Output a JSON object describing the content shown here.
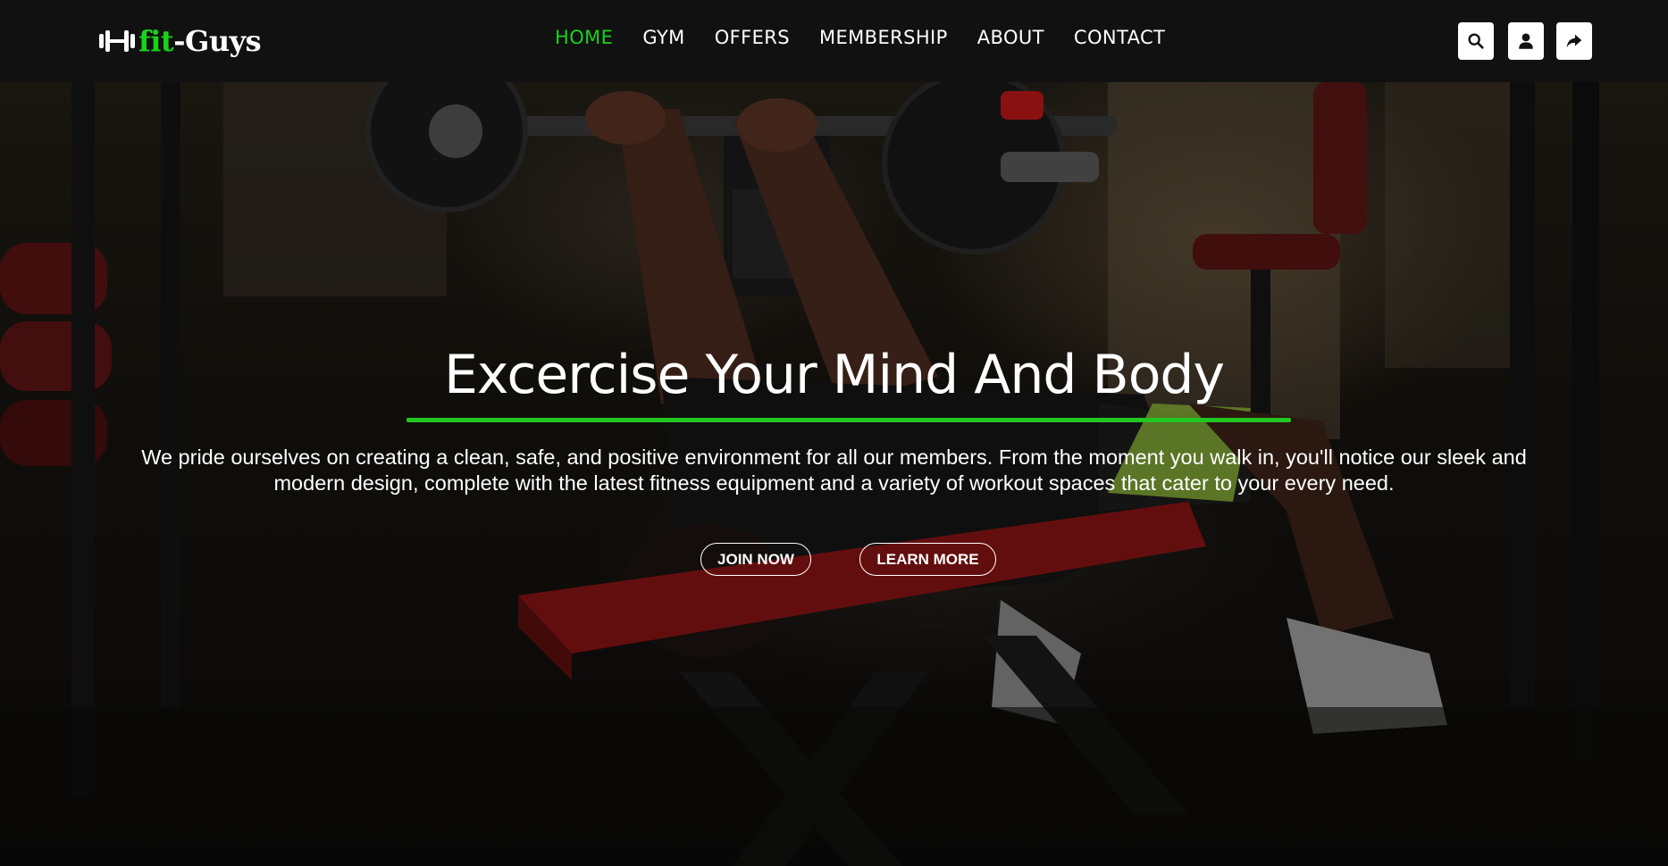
{
  "header": {
    "logo": {
      "icon": "dumbbell-icon",
      "accent_text": "fit",
      "rest_text": "-Guys"
    },
    "nav": [
      {
        "label": "HOME",
        "active": true
      },
      {
        "label": "GYM",
        "active": false
      },
      {
        "label": "OFFERS",
        "active": false
      },
      {
        "label": "MEMBERSHIP",
        "active": false
      },
      {
        "label": "ABOUT",
        "active": false
      },
      {
        "label": "CONTACT",
        "active": false
      }
    ],
    "actions": [
      {
        "icon": "search-icon"
      },
      {
        "icon": "user-icon"
      },
      {
        "icon": "share-icon"
      }
    ]
  },
  "hero": {
    "background": "gym-bench-press-photo",
    "title": "Excercise Your Mind And Body",
    "text": "We pride ourselves on creating a clean, safe, and positive environment for all our members. From the moment you walk in, you'll notice our sleek and modern design, complete with the latest fitness equipment and a variety of workout spaces that cater to your every need.",
    "buttons": {
      "join": "JOIN NOW",
      "learn": "LEARN MORE"
    }
  },
  "colors": {
    "accent": "#19d21a",
    "header_bg": "#111111",
    "text": "#ffffff"
  }
}
